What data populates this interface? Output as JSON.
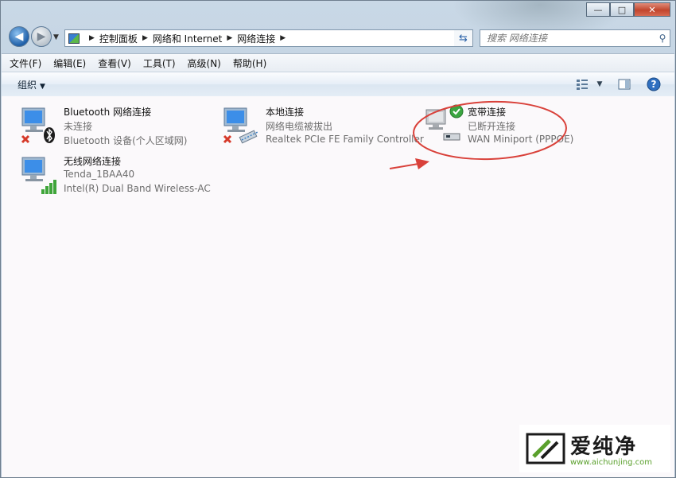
{
  "window": {
    "minimize_label": "—",
    "maximize_label": "□",
    "close_label": "✕"
  },
  "address_bar": {
    "breadcrumbs": [
      "控制面板",
      "网络和 Internet",
      "网络连接"
    ]
  },
  "search": {
    "placeholder": "搜索 网络连接"
  },
  "menu": [
    "文件(F)",
    "编辑(E)",
    "查看(V)",
    "工具(T)",
    "高级(N)",
    "帮助(H)"
  ],
  "command_bar": {
    "organize_label": "组织"
  },
  "connections": [
    {
      "name": "Bluetooth 网络连接",
      "status": "未连接",
      "device": "Bluetooth 设备(个人区域网)",
      "icon": "network-disconnected-bluetooth-icon"
    },
    {
      "name": "本地连接",
      "status": "网络电缆被拔出",
      "device": "Realtek PCIe FE Family Controller",
      "icon": "network-disconnected-ethernet-icon"
    },
    {
      "name": "宽带连接",
      "status": "已断开连接",
      "device": "WAN Miniport (PPPOE)",
      "icon": "broadband-connection-icon"
    },
    {
      "name": "无线网络连接",
      "status": "Tenda_1BAA40",
      "device": "Intel(R) Dual Band Wireless-AC",
      "icon": "wireless-connection-icon"
    }
  ],
  "annotation": {
    "color": "#d9413a"
  },
  "watermark": {
    "text": "爱纯净",
    "url": "www.aichunjing.com",
    "color": "#5aa02c"
  }
}
